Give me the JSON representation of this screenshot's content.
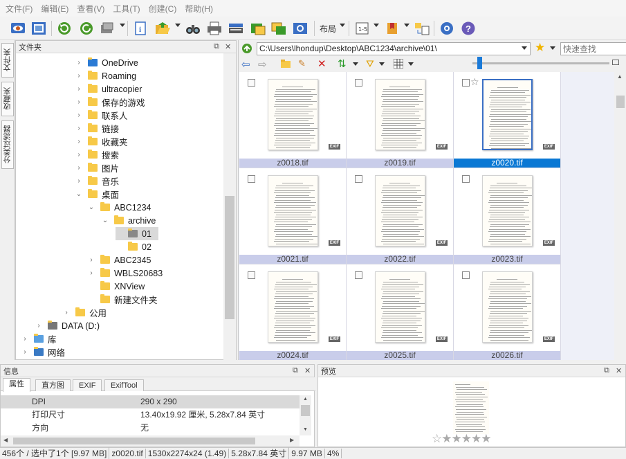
{
  "menu": [
    "文件(F)",
    "编辑(E)",
    "查看(V)",
    "工具(T)",
    "创建(C)",
    "帮助(H)"
  ],
  "toolbar": {
    "layout_label": "布局"
  },
  "sidetabs": [
    "文件夹",
    "收藏夹",
    "分类过滤器"
  ],
  "folder_panel": {
    "title": "文件夹",
    "items": [
      {
        "label": "OneDrive",
        "expanded": false
      },
      {
        "label": "Roaming",
        "expanded": false
      },
      {
        "label": "ultracopier",
        "expanded": false
      },
      {
        "label": "保存的游戏",
        "expanded": false
      },
      {
        "label": "联系人",
        "expanded": false
      },
      {
        "label": "链接",
        "expanded": false
      },
      {
        "label": "收藏夹",
        "expanded": false
      },
      {
        "label": "搜索",
        "expanded": false
      },
      {
        "label": "图片",
        "expanded": false
      },
      {
        "label": "音乐",
        "expanded": false
      },
      {
        "label": "桌面",
        "expanded": true
      },
      {
        "label": "ABC1234",
        "expanded": true
      },
      {
        "label": "archive",
        "expanded": true
      },
      {
        "label": "01",
        "selected": true
      },
      {
        "label": "02"
      },
      {
        "label": "ABC2345",
        "expanded": false
      },
      {
        "label": "WBLS20683",
        "expanded": false
      },
      {
        "label": "XNView"
      },
      {
        "label": "新建文件夹"
      },
      {
        "label": "公用",
        "expanded": false
      },
      {
        "label": "DATA (D:)",
        "expanded": false
      },
      {
        "label": "库",
        "expanded": false
      },
      {
        "label": "网络",
        "expanded": false
      }
    ]
  },
  "address": "C:\\Users\\lhondup\\Desktop\\ABC1234\\archive\\01\\",
  "quick_search_placeholder": "快速查找",
  "thumbnails": [
    {
      "name": "z0018.tif",
      "selected": false
    },
    {
      "name": "z0019.tif",
      "selected": false
    },
    {
      "name": "z0020.tif",
      "selected": true
    },
    {
      "name": "z0021.tif",
      "selected": false
    },
    {
      "name": "z0022.tif",
      "selected": false
    },
    {
      "name": "z0023.tif",
      "selected": false
    },
    {
      "name": "z0024.tif",
      "selected": false
    },
    {
      "name": "z0025.tif",
      "selected": false
    },
    {
      "name": "z0026.tif",
      "selected": false
    }
  ],
  "exif_badge": "EXIF",
  "info_panel": {
    "title": "信息",
    "tabs": [
      "属性",
      "直方图",
      "EXIF",
      "ExifTool"
    ],
    "rows": [
      {
        "key": "DPI",
        "value": "290 x 290"
      },
      {
        "key": "打印尺寸",
        "value": "13.40x19.92 厘米, 5.28x7.84 英寸"
      },
      {
        "key": "方向",
        "value": "无"
      }
    ]
  },
  "preview_panel": {
    "title": "预览",
    "rating": 0
  },
  "status": [
    "456个 / 选中了1个 [9.97 MB]",
    "z0020.tif",
    "1530x2274x24 (1.49)",
    "5.28x7.84 英寸",
    "9.97 MB",
    "4%"
  ],
  "colors": {
    "accent": "#0a78d4",
    "caption": "#c9cdea"
  }
}
